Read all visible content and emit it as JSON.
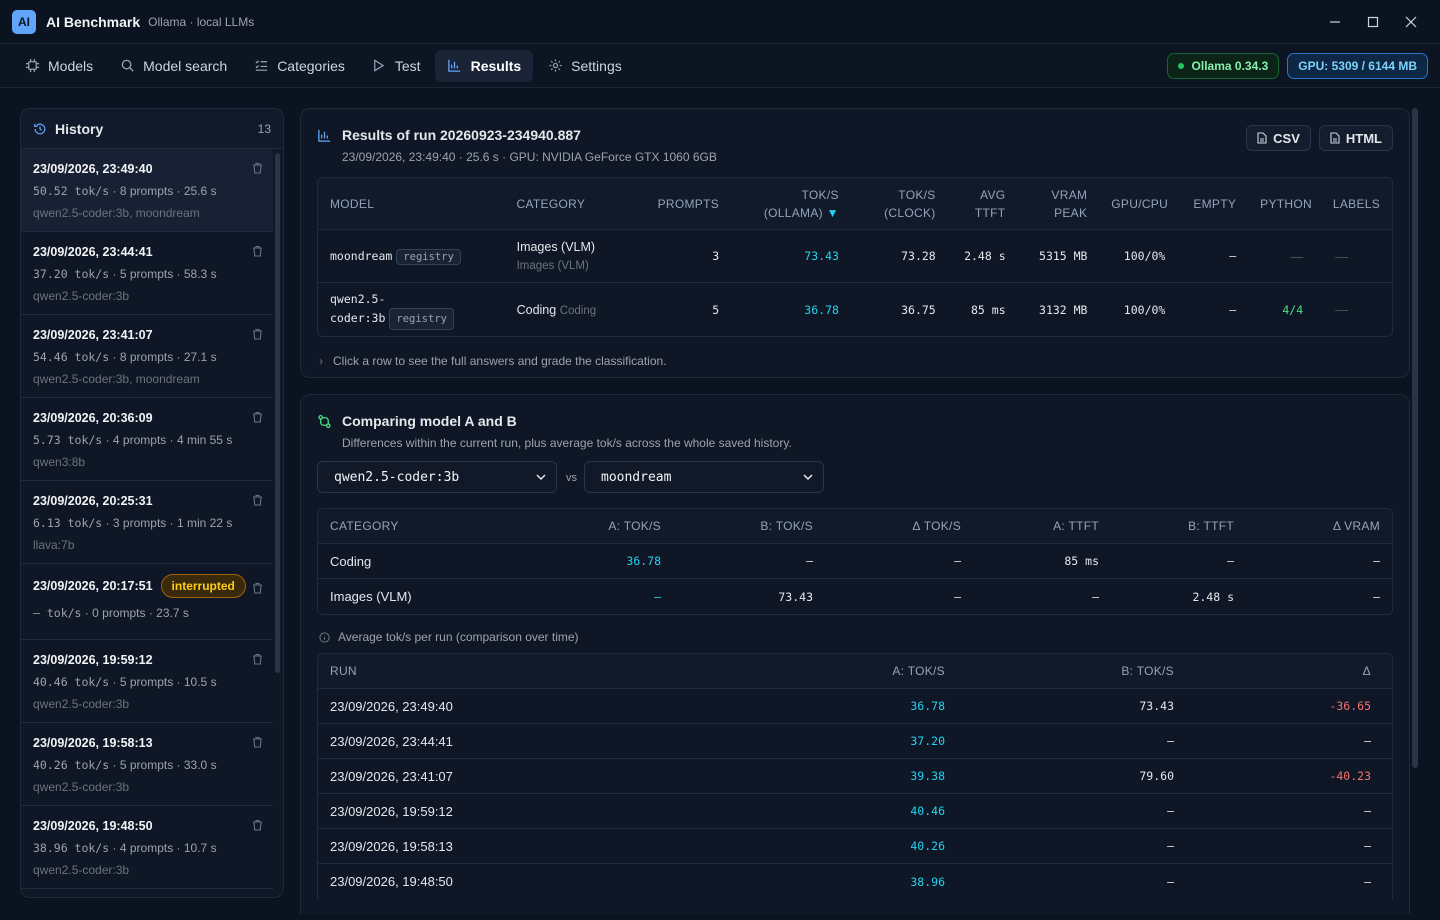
{
  "app": {
    "logo": "AI",
    "title": "AI Benchmark",
    "subtitle": "Ollama · local LLMs"
  },
  "nav": {
    "tabs": [
      {
        "label": "Models",
        "icon": "cpu-icon"
      },
      {
        "label": "Model search",
        "icon": "search-icon"
      },
      {
        "label": "Categories",
        "icon": "list-icon"
      },
      {
        "label": "Test",
        "icon": "play-icon"
      },
      {
        "label": "Results",
        "icon": "bar-chart-icon"
      },
      {
        "label": "Settings",
        "icon": "gear-icon"
      }
    ],
    "active": "Results",
    "ollama_pill": "Ollama 0.34.3",
    "gpu_pill": "GPU: 5309 / 6144 MB"
  },
  "history": {
    "title": "History",
    "count": "13",
    "items": [
      {
        "date": "23/09/2026, 23:49:40",
        "toks": "50.52 tok/s",
        "prompts": "8 prompts",
        "duration": "25.6 s",
        "models": "qwen2.5-coder:3b, moondream"
      },
      {
        "date": "23/09/2026, 23:44:41",
        "toks": "37.20 tok/s",
        "prompts": "5 prompts",
        "duration": "58.3 s",
        "models": "qwen2.5-coder:3b"
      },
      {
        "date": "23/09/2026, 23:41:07",
        "toks": "54.46 tok/s",
        "prompts": "8 prompts",
        "duration": "27.1 s",
        "models": "qwen2.5-coder:3b, moondream"
      },
      {
        "date": "23/09/2026, 20:36:09",
        "toks": "5.73 tok/s",
        "prompts": "4 prompts",
        "duration": "4 min 55 s",
        "models": "qwen3:8b"
      },
      {
        "date": "23/09/2026, 20:25:31",
        "toks": "6.13 tok/s",
        "prompts": "3 prompts",
        "duration": "1 min 22 s",
        "models": "llava:7b"
      },
      {
        "date": "23/09/2026, 20:17:51",
        "toks": "– tok/s",
        "prompts": "0 prompts",
        "duration": "23.7 s",
        "models": "",
        "badge": "interrupted"
      },
      {
        "date": "23/09/2026, 19:59:12",
        "toks": "40.46 tok/s",
        "prompts": "5 prompts",
        "duration": "10.5 s",
        "models": "qwen2.5-coder:3b"
      },
      {
        "date": "23/09/2026, 19:58:13",
        "toks": "40.26 tok/s",
        "prompts": "5 prompts",
        "duration": "33.0 s",
        "models": "qwen2.5-coder:3b"
      },
      {
        "date": "23/09/2026, 19:48:50",
        "toks": "38.96 tok/s",
        "prompts": "4 prompts",
        "duration": "10.7 s",
        "models": "qwen2.5-coder:3b"
      }
    ]
  },
  "results": {
    "title": "Results of run 20260923-234940.887",
    "subtitle": "23/09/2026, 23:49:40 · 25.6 s · GPU: NVIDIA GeForce GTX 1060 6GB",
    "csv_label": "CSV",
    "html_label": "HTML",
    "columns": {
      "model": "MODEL",
      "category": "CATEGORY",
      "prompts": "PROMPTS",
      "toks_ollama_1": "TOK/S",
      "toks_ollama_2": "(OLLAMA)",
      "toks_clock_1": "TOK/S",
      "toks_clock_2": "(CLOCK)",
      "ttft_1": "AVG",
      "ttft_2": "TTFT",
      "vram_1": "VRAM",
      "vram_2": "PEAK",
      "gpucpu": "GPU/CPU",
      "empty": "EMPTY",
      "python": "PYTHON",
      "labels": "LABELS"
    },
    "rows": [
      {
        "model": "moondream",
        "tag": "registry",
        "category": "Images (VLM)",
        "category_sub": "Images (VLM)",
        "prompts": "3",
        "toks_ollama": "73.43",
        "toks_clock": "73.28",
        "ttft": "2.48 s",
        "vram": "5315 MB",
        "gpucpu": "100/0%",
        "empty": "–",
        "python": "—",
        "labels": "—"
      },
      {
        "model": "qwen2.5-coder:3b",
        "model_l1": "qwen2.5-",
        "model_l2": "coder:3b",
        "tag": "registry",
        "category": "Coding",
        "category_sub": "Coding",
        "prompts": "5",
        "toks_ollama": "36.78",
        "toks_clock": "36.75",
        "ttft": "85 ms",
        "vram": "3132 MB",
        "gpucpu": "100/0%",
        "empty": "–",
        "python": "4/4",
        "labels": "—"
      }
    ],
    "hint": "Click a row to see the full answers and grade the classification."
  },
  "compare": {
    "title": "Comparing model A and B",
    "subtitle": "Differences within the current run, plus average tok/s across the whole saved history.",
    "model_a": "qwen2.5-coder:3b",
    "vs": "vs",
    "model_b": "moondream",
    "columns": {
      "category": "CATEGORY",
      "a_toks": "A: TOK/S",
      "b_toks": "B: TOK/S",
      "d_toks": "Δ TOK/S",
      "a_ttft": "A: TTFT",
      "b_ttft": "B: TTFT",
      "d_vram": "Δ VRAM"
    },
    "rows": [
      {
        "category": "Coding",
        "a_toks": "36.78",
        "b_toks": "–",
        "d_toks": "–",
        "a_ttft": "85 ms",
        "b_ttft": "–",
        "d_vram": "–"
      },
      {
        "category": "Images (VLM)",
        "a_toks": "–",
        "b_toks": "73.43",
        "d_toks": "–",
        "a_ttft": "–",
        "b_ttft": "2.48 s",
        "d_vram": "–"
      }
    ],
    "history_caption": "Average tok/s per run (comparison over time)",
    "history_columns": {
      "run": "RUN",
      "a": "A: TOK/S",
      "b": "B: TOK/S",
      "delta": "Δ"
    },
    "history_rows": [
      {
        "run": "23/09/2026, 23:49:40",
        "a": "36.78",
        "b": "73.43",
        "delta": "-36.65"
      },
      {
        "run": "23/09/2026, 23:44:41",
        "a": "37.20",
        "b": "–",
        "delta": "–"
      },
      {
        "run": "23/09/2026, 23:41:07",
        "a": "39.38",
        "b": "79.60",
        "delta": "-40.23"
      },
      {
        "run": "23/09/2026, 19:59:12",
        "a": "40.46",
        "b": "–",
        "delta": "–"
      },
      {
        "run": "23/09/2026, 19:58:13",
        "a": "40.26",
        "b": "–",
        "delta": "–"
      },
      {
        "run": "23/09/2026, 19:48:50",
        "a": "38.96",
        "b": "–",
        "delta": "–"
      }
    ]
  }
}
